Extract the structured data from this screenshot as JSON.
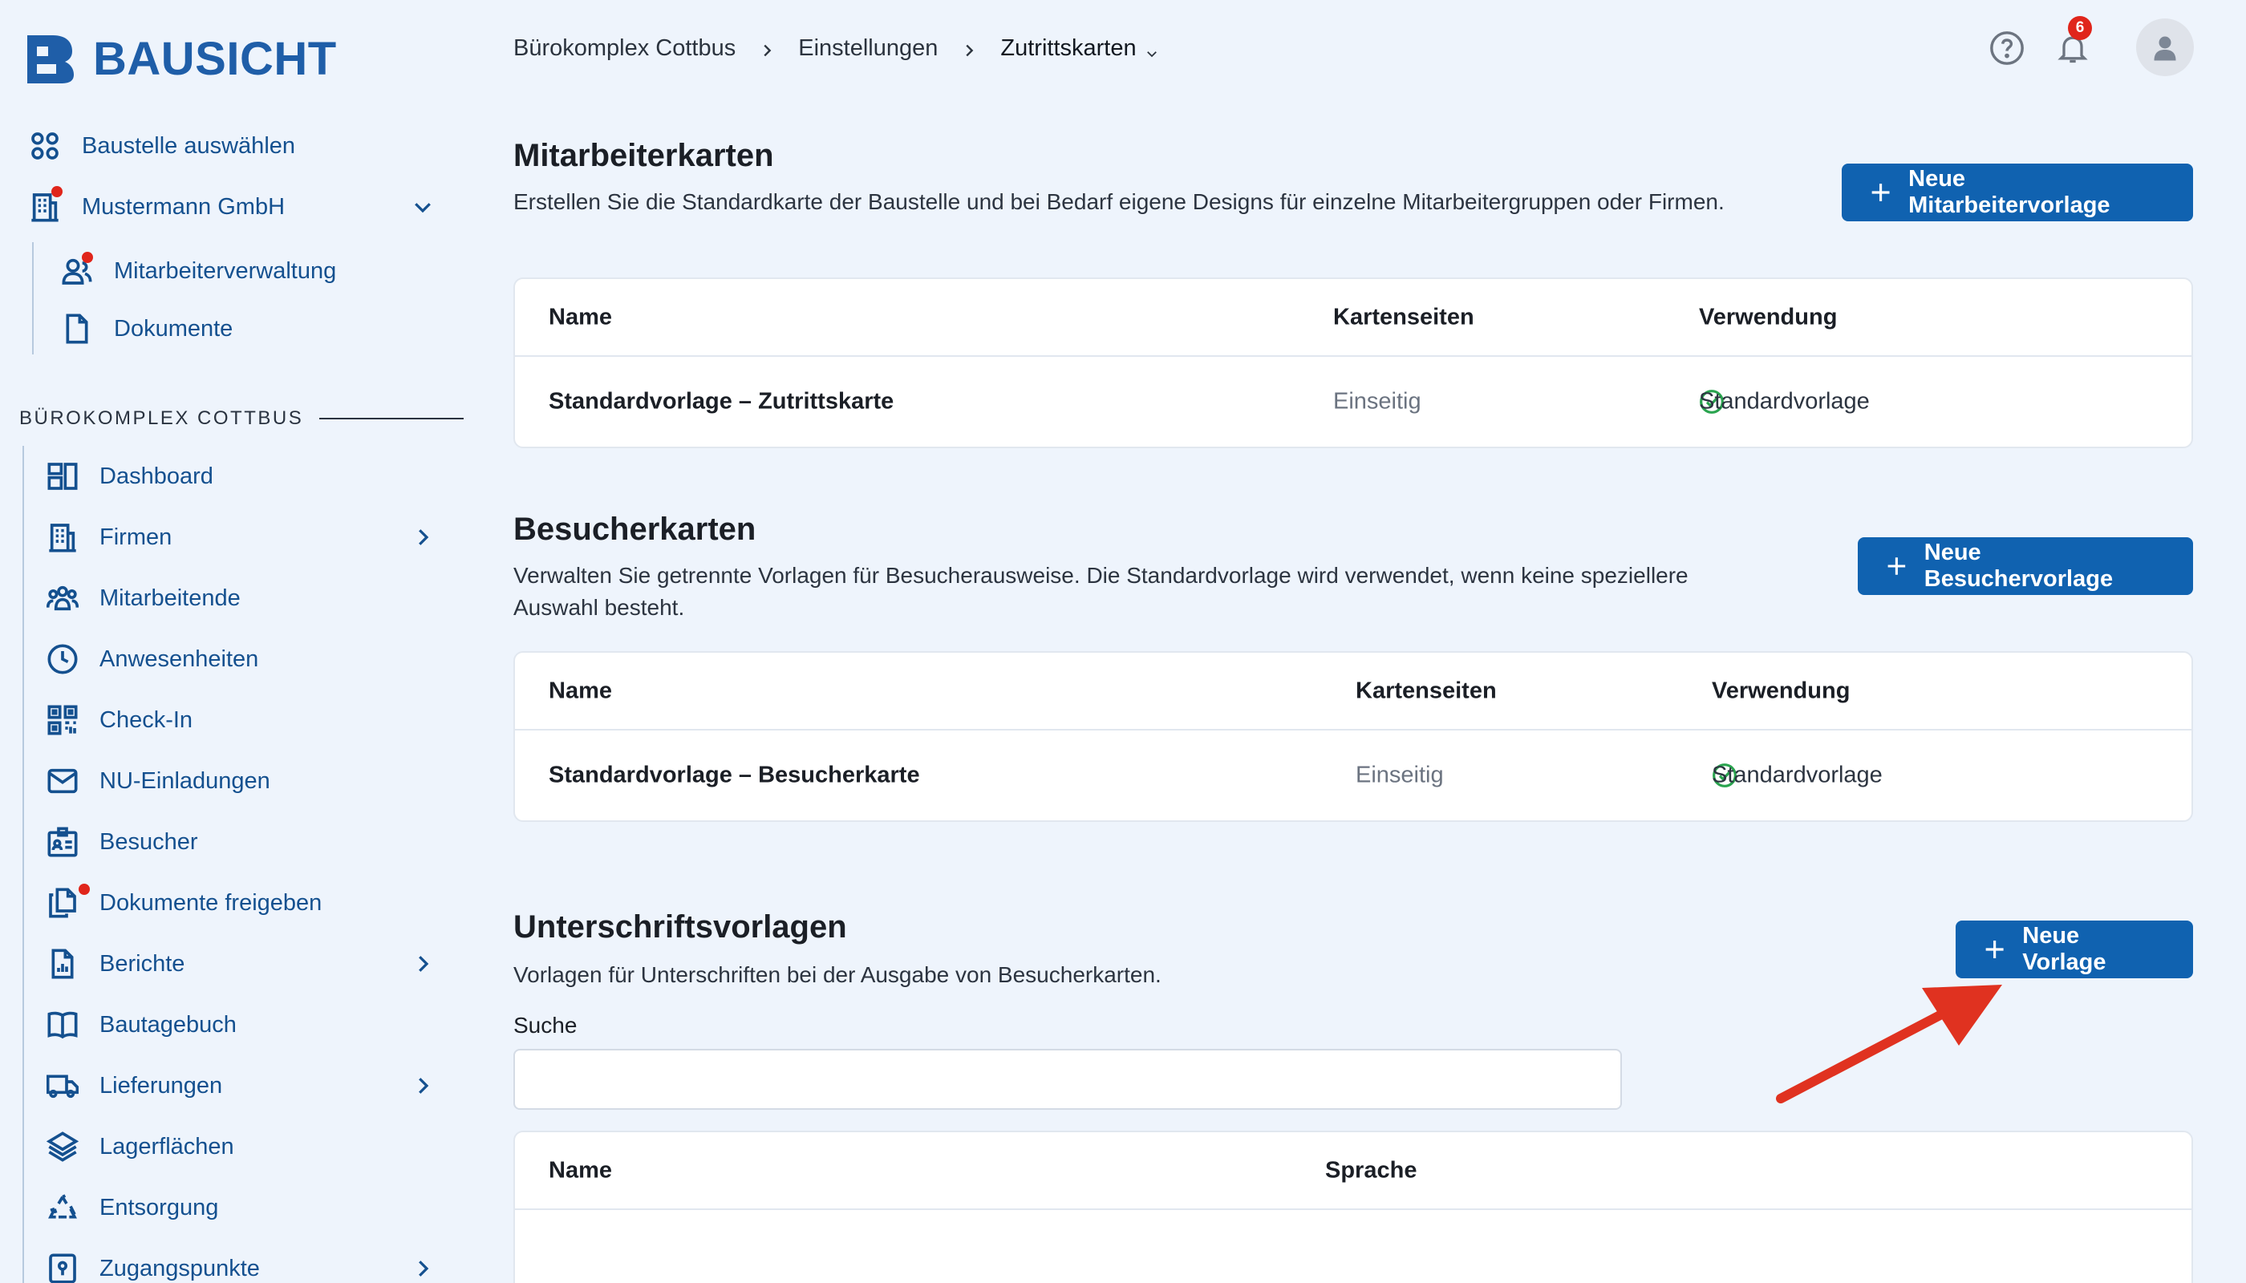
{
  "brand": {
    "name": "BAUSICHT",
    "color": "#1f5ea8"
  },
  "sidebar": {
    "top_items": [
      {
        "label": "Baustelle auswählen",
        "icon": "grid-icon"
      },
      {
        "label": "Mustermann GmbH",
        "icon": "building-icon",
        "has_dot": true,
        "expanded": true
      }
    ],
    "sub_items": [
      {
        "label": "Mitarbeiterverwaltung",
        "icon": "users-icon",
        "has_dot": true
      },
      {
        "label": "Dokumente",
        "icon": "document-icon"
      }
    ],
    "section_title": "BÜROKOMPLEX COTTBUS",
    "items": [
      {
        "label": "Dashboard",
        "icon": "dashboard-icon"
      },
      {
        "label": "Firmen",
        "icon": "building-icon",
        "has_chevron": true
      },
      {
        "label": "Mitarbeitende",
        "icon": "team-icon"
      },
      {
        "label": "Anwesenheiten",
        "icon": "clock-icon"
      },
      {
        "label": "Check-In",
        "icon": "qr-code-icon"
      },
      {
        "label": "NU-Einladungen",
        "icon": "mail-icon"
      },
      {
        "label": "Besucher",
        "icon": "visitor-badge-icon"
      },
      {
        "label": "Dokumente freigeben",
        "icon": "documents-icon",
        "has_dot": true
      },
      {
        "label": "Berichte",
        "icon": "report-icon",
        "has_chevron": true
      },
      {
        "label": "Bautagebuch",
        "icon": "book-icon"
      },
      {
        "label": "Lieferungen",
        "icon": "truck-icon",
        "has_chevron": true
      },
      {
        "label": "Lagerflächen",
        "icon": "layers-icon"
      },
      {
        "label": "Entsorgung",
        "icon": "recycle-icon"
      },
      {
        "label": "Zugangspunkte",
        "icon": "access-point-icon",
        "has_chevron": true
      }
    ]
  },
  "breadcrumb": {
    "items": [
      "Bürokomplex Cottbus",
      "Einstellungen"
    ],
    "current": "Zutrittskarten"
  },
  "topbar": {
    "notification_count": "6"
  },
  "employee_cards": {
    "title": "Mitarbeiterkarten",
    "description": "Erstellen Sie die Standardkarte der Baustelle und bei Bedarf eigene Designs für einzelne Mitarbeitergruppen oder Firmen.",
    "button": "Neue Mitarbeitervorlage",
    "columns": [
      "Name",
      "Kartenseiten",
      "Verwendung"
    ],
    "rows": [
      {
        "name": "Standardvorlage – Zutrittskarte",
        "sides": "Einseitig",
        "usage": "Standardvorlage"
      }
    ]
  },
  "visitor_cards": {
    "title": "Besucherkarten",
    "description": "Verwalten Sie getrennte Vorlagen für Besucherausweise. Die Standardvorlage wird verwendet, wenn keine speziellere Auswahl besteht.",
    "button": "Neue Besuchervorlage",
    "columns": [
      "Name",
      "Kartenseiten",
      "Verwendung"
    ],
    "rows": [
      {
        "name": "Standardvorlage – Besucherkarte",
        "sides": "Einseitig",
        "usage": "Standardvorlage"
      }
    ]
  },
  "signature_templates": {
    "title": "Unterschriftsvorlagen",
    "description": "Vorlagen für Unterschriften bei der Ausgabe von Besucherkarten.",
    "button": "Neue Vorlage",
    "search_label": "Suche",
    "search_value": "",
    "columns": [
      "Name",
      "Sprache"
    ]
  },
  "colors": {
    "primary_button": "#1062b0",
    "accent": "#14508f",
    "alert": "#e0251b",
    "success": "#2aa44f",
    "annotation_arrow": "#e03220"
  }
}
